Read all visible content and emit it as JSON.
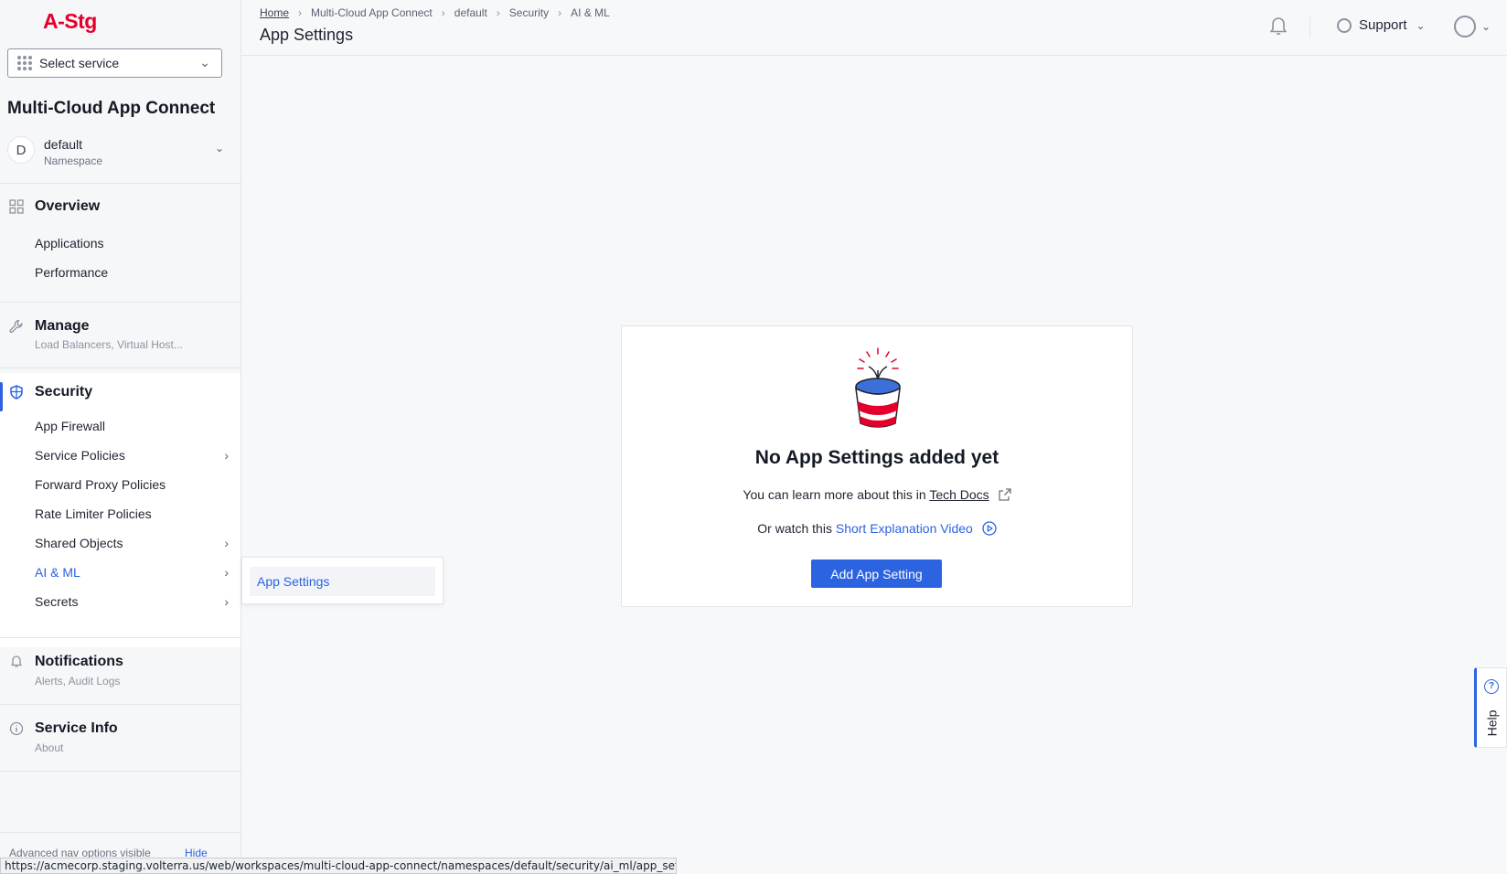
{
  "sidebar": {
    "logo": "A-Stg",
    "select_service": "Select service",
    "app_name": "Multi-Cloud App Connect",
    "namespace": {
      "avatar": "D",
      "name": "default",
      "label": "Namespace"
    },
    "overview": {
      "title": "Overview",
      "items": [
        "Applications",
        "Performance"
      ]
    },
    "manage": {
      "title": "Manage",
      "subtitle": "Load Balancers, Virtual Host..."
    },
    "security": {
      "title": "Security",
      "items": [
        "App Firewall",
        "Service Policies",
        "Forward Proxy Policies",
        "Rate Limiter Policies",
        "Shared Objects",
        "AI & ML",
        "Secrets"
      ]
    },
    "notifications": {
      "title": "Notifications",
      "subtitle": "Alerts, Audit Logs"
    },
    "service_info": {
      "title": "Service Info",
      "subtitle": "About"
    },
    "advanced_nav": "Advanced nav options visible",
    "hide": "Hide"
  },
  "header": {
    "breadcrumb": [
      "Home",
      "Multi-Cloud App Connect",
      "default",
      "Security",
      "AI & ML"
    ],
    "title": "App Settings",
    "support": "Support"
  },
  "flyout": {
    "item": "App Settings"
  },
  "empty_state": {
    "title": "No App Settings added yet",
    "learn_prefix": "You can learn more about this in",
    "learn_link": "Tech Docs",
    "watch_prefix": "Or watch this",
    "watch_link": "Short Explanation Video",
    "button": "Add App Setting"
  },
  "help": "Help",
  "status_url": "https://acmecorp.staging.volterra.us/web/workspaces/multi-cloud-app-connect/namespaces/default/security/ai_ml/app_settings",
  "colors": {
    "accent": "#2b63e0",
    "brand": "#e4002b"
  }
}
